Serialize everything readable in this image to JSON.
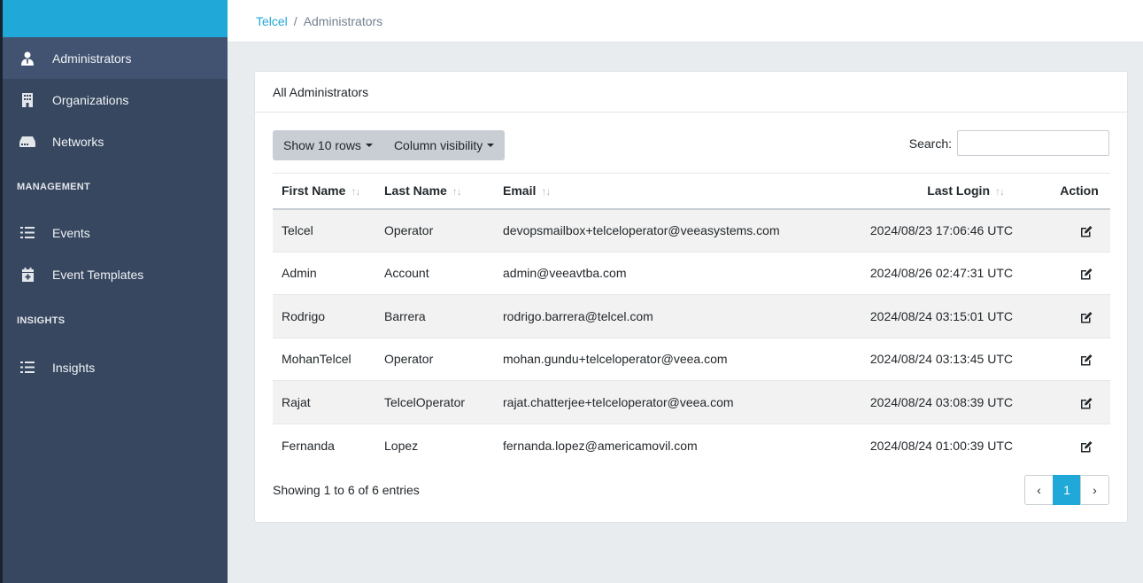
{
  "colors": {
    "brand": "#20a8d8",
    "sidebar": "#374760",
    "sidebar_active": "#425372"
  },
  "breadcrumb": {
    "root": "Telcel",
    "separator": "/",
    "current": "Administrators"
  },
  "sidebar": {
    "items": [
      {
        "label": "Administrators",
        "icon": "admin-user-icon",
        "active": true
      },
      {
        "label": "Organizations",
        "icon": "building-icon"
      },
      {
        "label": "Networks",
        "icon": "router-icon"
      }
    ],
    "management_title": "MANAGEMENT",
    "management_items": [
      {
        "label": "Events",
        "icon": "list-icon"
      },
      {
        "label": "Event Templates",
        "icon": "calendar-plus-icon"
      }
    ],
    "insights_title": "INSIGHTS",
    "insights_items": [
      {
        "label": "Insights",
        "icon": "list-icon"
      }
    ]
  },
  "card": {
    "title": "All Administrators",
    "show_rows_label": "Show 10 rows",
    "column_visibility_label": "Column visibility",
    "search_label": "Search:",
    "search_value": "",
    "columns": [
      "First Name",
      "Last Name",
      "Email",
      "Last Login",
      "Action"
    ],
    "sort_glyph": "↑↓",
    "rows": [
      {
        "first": "Telcel",
        "last": "Operator",
        "email": "devopsmailbox+telceloperator@veeasystems.com",
        "login": "2024/08/23 17:06:46 UTC"
      },
      {
        "first": "Admin",
        "last": "Account",
        "email": "admin@veeavtba.com",
        "login": "2024/08/26 02:47:31 UTC"
      },
      {
        "first": "Rodrigo",
        "last": "Barrera",
        "email": "rodrigo.barrera@telcel.com",
        "login": "2024/08/24 03:15:01 UTC"
      },
      {
        "first": "MohanTelcel",
        "last": "Operator",
        "email": "mohan.gundu+telceloperator@veea.com",
        "login": "2024/08/24 03:13:45 UTC"
      },
      {
        "first": "Rajat",
        "last": "TelcelOperator",
        "email": "rajat.chatterjee+telceloperator@veea.com",
        "login": "2024/08/24 03:08:39 UTC"
      },
      {
        "first": "Fernanda",
        "last": "Lopez",
        "email": "fernanda.lopez@americamovil.com",
        "login": "2024/08/24 01:00:39 UTC"
      }
    ],
    "info": "Showing 1 to 6 of 6 entries",
    "pagination": {
      "prev": "‹",
      "current": "1",
      "next": "›"
    }
  }
}
